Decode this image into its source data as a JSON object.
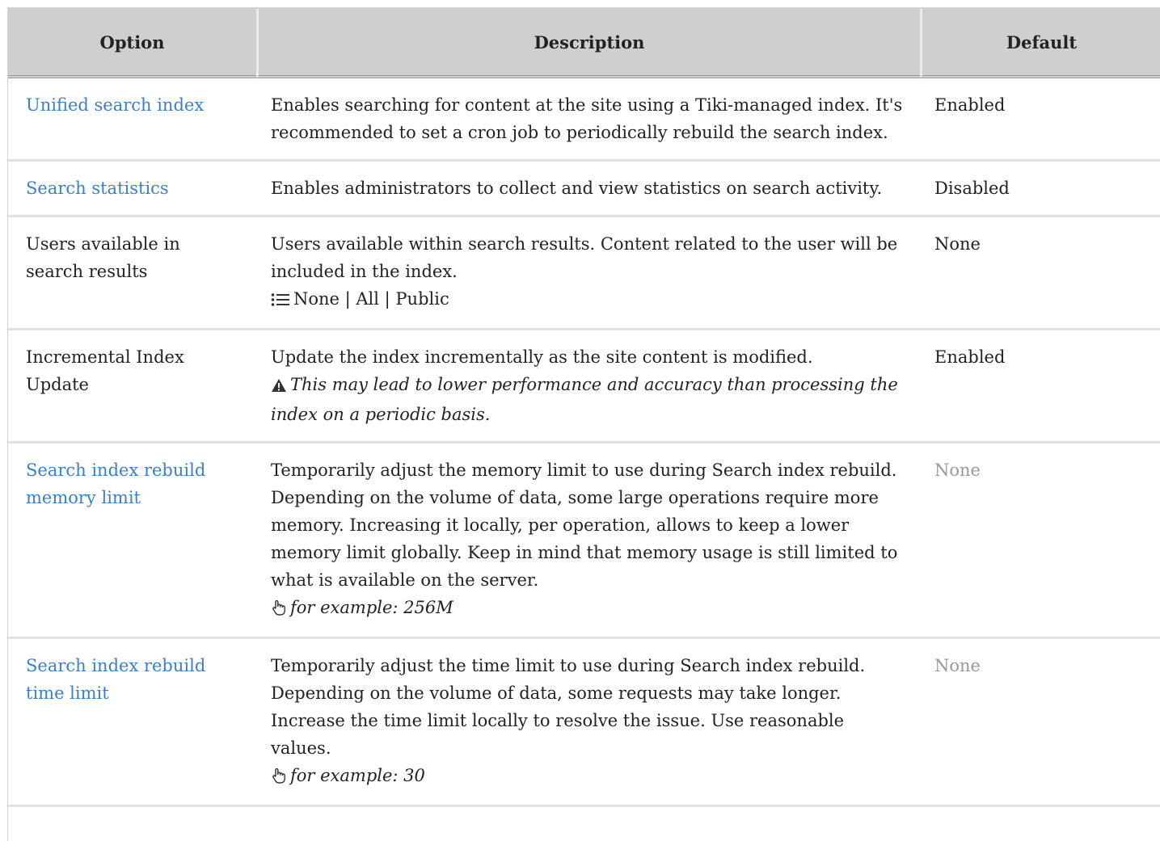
{
  "headers": {
    "option": "Option",
    "description": "Description",
    "default": "Default"
  },
  "rows": [
    {
      "option": "Unified search index",
      "option_is_link": true,
      "description": "Enables searching for content at the site using a Tiki-managed index. It's recommended to set a cron job to periodically rebuild the search index.",
      "default": "Enabled"
    },
    {
      "option": "Search statistics",
      "option_is_link": true,
      "description": "Enables administrators to collect and view statistics on search activity.",
      "default": "Disabled"
    },
    {
      "option": "Users available in search results",
      "option_is_link": false,
      "description": "Users available within search results. Content related to the user will be included in the index.",
      "options_list": "None | All | Public",
      "options_icon": "list-icon",
      "default": "None"
    },
    {
      "option": "Incremental Index Update",
      "option_is_link": false,
      "description": "Update the index incrementally as the site content is modified.",
      "warning": "This may lead to lower performance and accuracy than processing the index on a periodic basis.",
      "warning_icon": "warning-icon",
      "default": "Enabled"
    },
    {
      "option": "Search index rebuild memory limit",
      "option_is_link": true,
      "description": "Temporarily adjust the memory limit to use during Search index rebuild. Depending on the volume of data, some large operations require more memory. Increasing it locally, per operation, allows to keep a lower memory limit globally. Keep in mind that memory usage is still limited to what is available on the server.",
      "example": "for example: 256M",
      "example_icon": "hand-pointer-icon",
      "default": "None",
      "default_muted": true
    },
    {
      "option": "Search index rebuild time limit",
      "option_is_link": true,
      "description": "Temporarily adjust the time limit to use during Search index rebuild. Depending on the volume of data, some requests may take longer. Increase the time limit locally to resolve the issue. Use reasonable values.",
      "example": "for example: 30",
      "example_icon": "hand-pointer-icon",
      "default": "None",
      "default_muted": true
    }
  ],
  "colors": {
    "link": "#3b7fc4",
    "header_bg": "#cfcfcf",
    "muted": "#999999"
  }
}
